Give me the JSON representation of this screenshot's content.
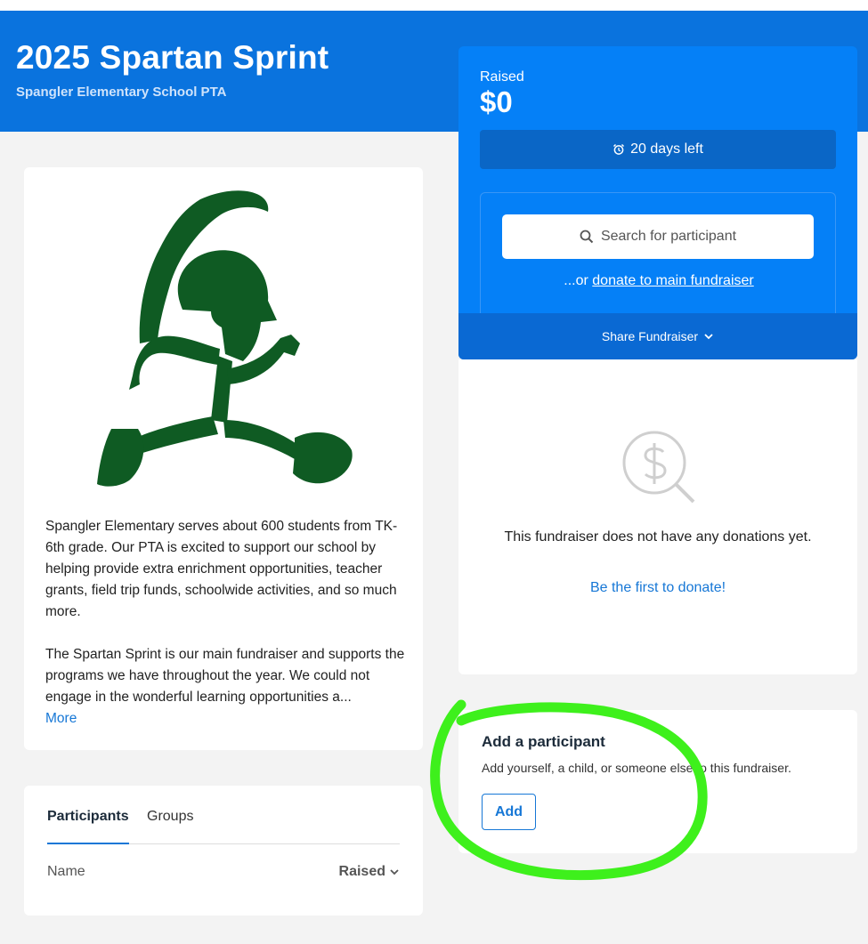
{
  "header": {
    "title": "2025 Spartan Sprint",
    "organization": "Spangler Elementary School PTA",
    "brand_color": "#0a73de"
  },
  "story": {
    "logo_icon": "spartan-runner-logo",
    "paragraph_1": "Spangler Elementary serves about 600 students from TK-6th grade. Our PTA is excited to support our school by helping provide extra enrichment opportunities, teacher grants, field trip funds, schoolwide activities, and so much more.",
    "paragraph_2": "The Spartan Sprint is our main fundraiser and supports the programs we have throughout the year. We could not engage in the wonderful learning opportunities a...",
    "more_label": "More"
  },
  "participants": {
    "tabs": [
      {
        "label": "Participants",
        "active": true
      },
      {
        "label": "Groups",
        "active": false
      }
    ],
    "columns": {
      "name": "Name",
      "raised": "Raised"
    }
  },
  "donate": {
    "raised_label": "Raised",
    "raised_amount": "$0",
    "days_left": "20 days left",
    "search_placeholder": "Search for participant",
    "or_prefix": "...or ",
    "donate_link": "donate to main fundraiser",
    "share_label": "Share Fundraiser",
    "card_color": "#0580f7"
  },
  "donations": {
    "empty_icon": "dollar-magnifier-icon",
    "empty_text": "This fundraiser does not have any donations yet.",
    "first_donate": "Be the first to donate!"
  },
  "add_participant": {
    "title": "Add a participant",
    "description": "Add yourself, a child, or someone else to this fundraiser.",
    "button_label": "Add",
    "highlight_color": "#3ef01c"
  }
}
